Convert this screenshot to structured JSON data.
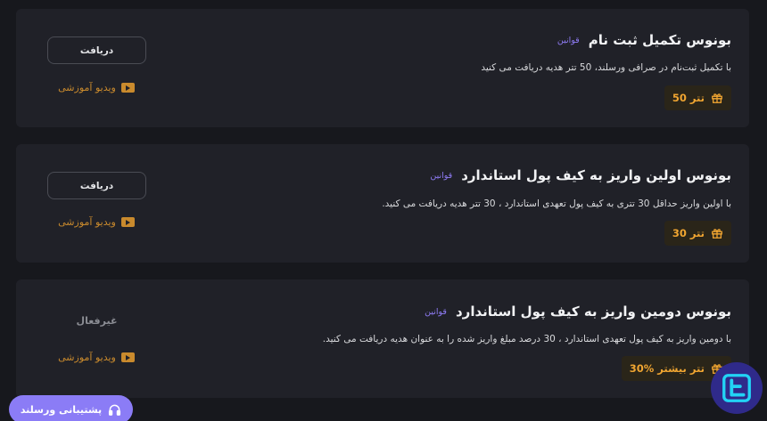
{
  "bonuses": [
    {
      "title": "بونوس تکمیل ثبت نام",
      "rules": "قوانین",
      "description": "با تکمیل ثبت‌نام در صرافی ورسلند، 50 تتر هدیه دریافت می کنید",
      "reward": "50 تتر",
      "action": "دریافت",
      "video": "ویدیو آموزشی"
    },
    {
      "title": "بونوس اولین واریز به کیف پول استاندارد",
      "rules": "قوانین",
      "description": "با اولین واریز حداقل 30 تتری به کیف پول تعهدی استاندارد ، 30 تتر هدیه دریافت می کنید.",
      "reward": "30 تتر",
      "action": "دریافت",
      "video": "ویدیو آموزشی"
    },
    {
      "title": "بونوس دومین واریز به کیف پول استاندارد",
      "rules": "قوانین",
      "description": "با دومین واریز به کیف پول تعهدی استاندارد ، 30 درصد مبلغ واریز شده را به عنوان هدیه دریافت می کنید.",
      "reward": "30% تتر بیشتر",
      "status": "غیرفعال",
      "video": "ویدیو آموزشی"
    }
  ],
  "support": {
    "label": "پشتیبانی ورسلند",
    "icon": "headset-icon"
  },
  "icons": {
    "reward": "gift-icon",
    "video": "play-icon",
    "logo": "brand-logo-icon"
  },
  "colors": {
    "background": "#17181d",
    "card": "#202128",
    "accent": "#8b7cf6",
    "reward": "#f0a531",
    "video": "#c98a2d"
  }
}
